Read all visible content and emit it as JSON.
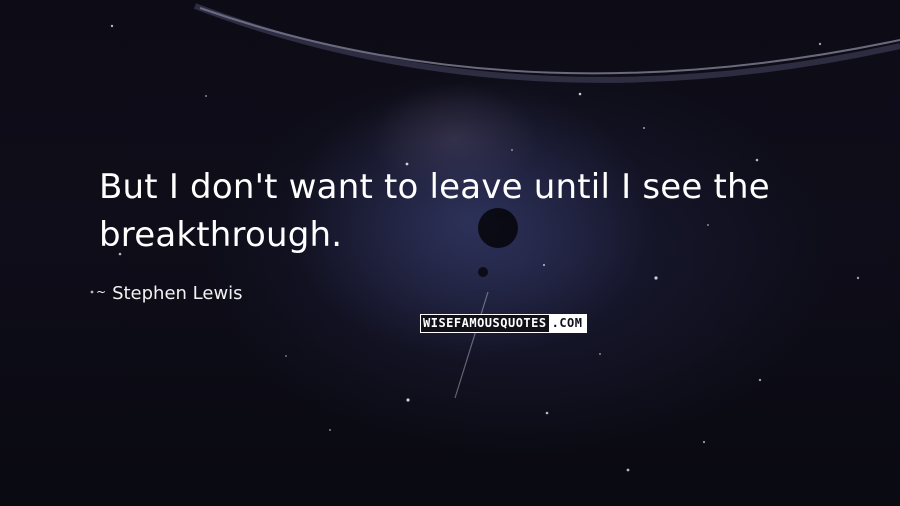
{
  "quote": {
    "text": "But I don't want to leave until I see the breakthrough."
  },
  "author": {
    "tilde": "~",
    "name": "Stephen Lewis"
  },
  "brand": {
    "main": "WISEFAMOUSQUOTES",
    "tld": ".COM"
  },
  "colors": {
    "background": "#0d0c16",
    "text": "#ffffff"
  }
}
